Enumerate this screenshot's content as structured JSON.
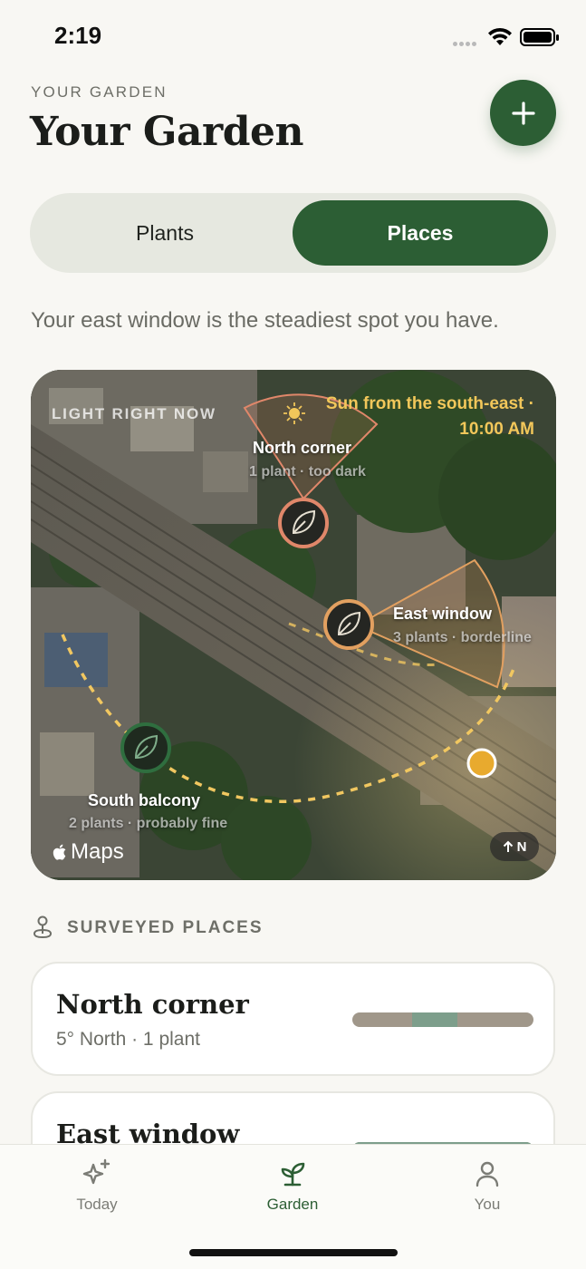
{
  "status_bar": {
    "time": "2:19"
  },
  "header": {
    "eyebrow": "YOUR GARDEN",
    "title": "Your Garden",
    "add_icon": "plus-icon"
  },
  "segmented": {
    "tabs": [
      "Plants",
      "Places"
    ],
    "selected": "Places"
  },
  "subtitle": "Your east window is the steadiest spot you have.",
  "map": {
    "eyebrow": "LIGHT RIGHT NOW",
    "sun_caption_line1": "Sun from the south-east ·",
    "sun_caption_line2": "10:00 AM",
    "places": [
      {
        "name": "North corner",
        "meta": "1 plant · too dark",
        "color": "#e0876a"
      },
      {
        "name": "East window",
        "meta": "3 plants · borderline",
        "color": "#e2a060"
      },
      {
        "name": "South balcony",
        "meta": "2 plants · probably fine",
        "color": "#2f6e3f"
      }
    ],
    "maps_label": "Maps",
    "north_label": "N",
    "sun_color": "#e8aa2e"
  },
  "surveyed": {
    "title": "SURVEYED PLACES",
    "cards": [
      {
        "name": "North corner",
        "meta": "5° North · 1 plant",
        "good_start": 0.33,
        "good_end": 0.58
      },
      {
        "name": "East window",
        "meta": "",
        "good_start": 0.0,
        "good_end": 1.0
      }
    ]
  },
  "tab_bar": {
    "items": [
      {
        "label": "Today",
        "icon": "sparkles-icon"
      },
      {
        "label": "Garden",
        "icon": "sprout-icon"
      },
      {
        "label": "You",
        "icon": "person-icon"
      }
    ],
    "active": "Garden",
    "accent": "#2c5e34"
  }
}
